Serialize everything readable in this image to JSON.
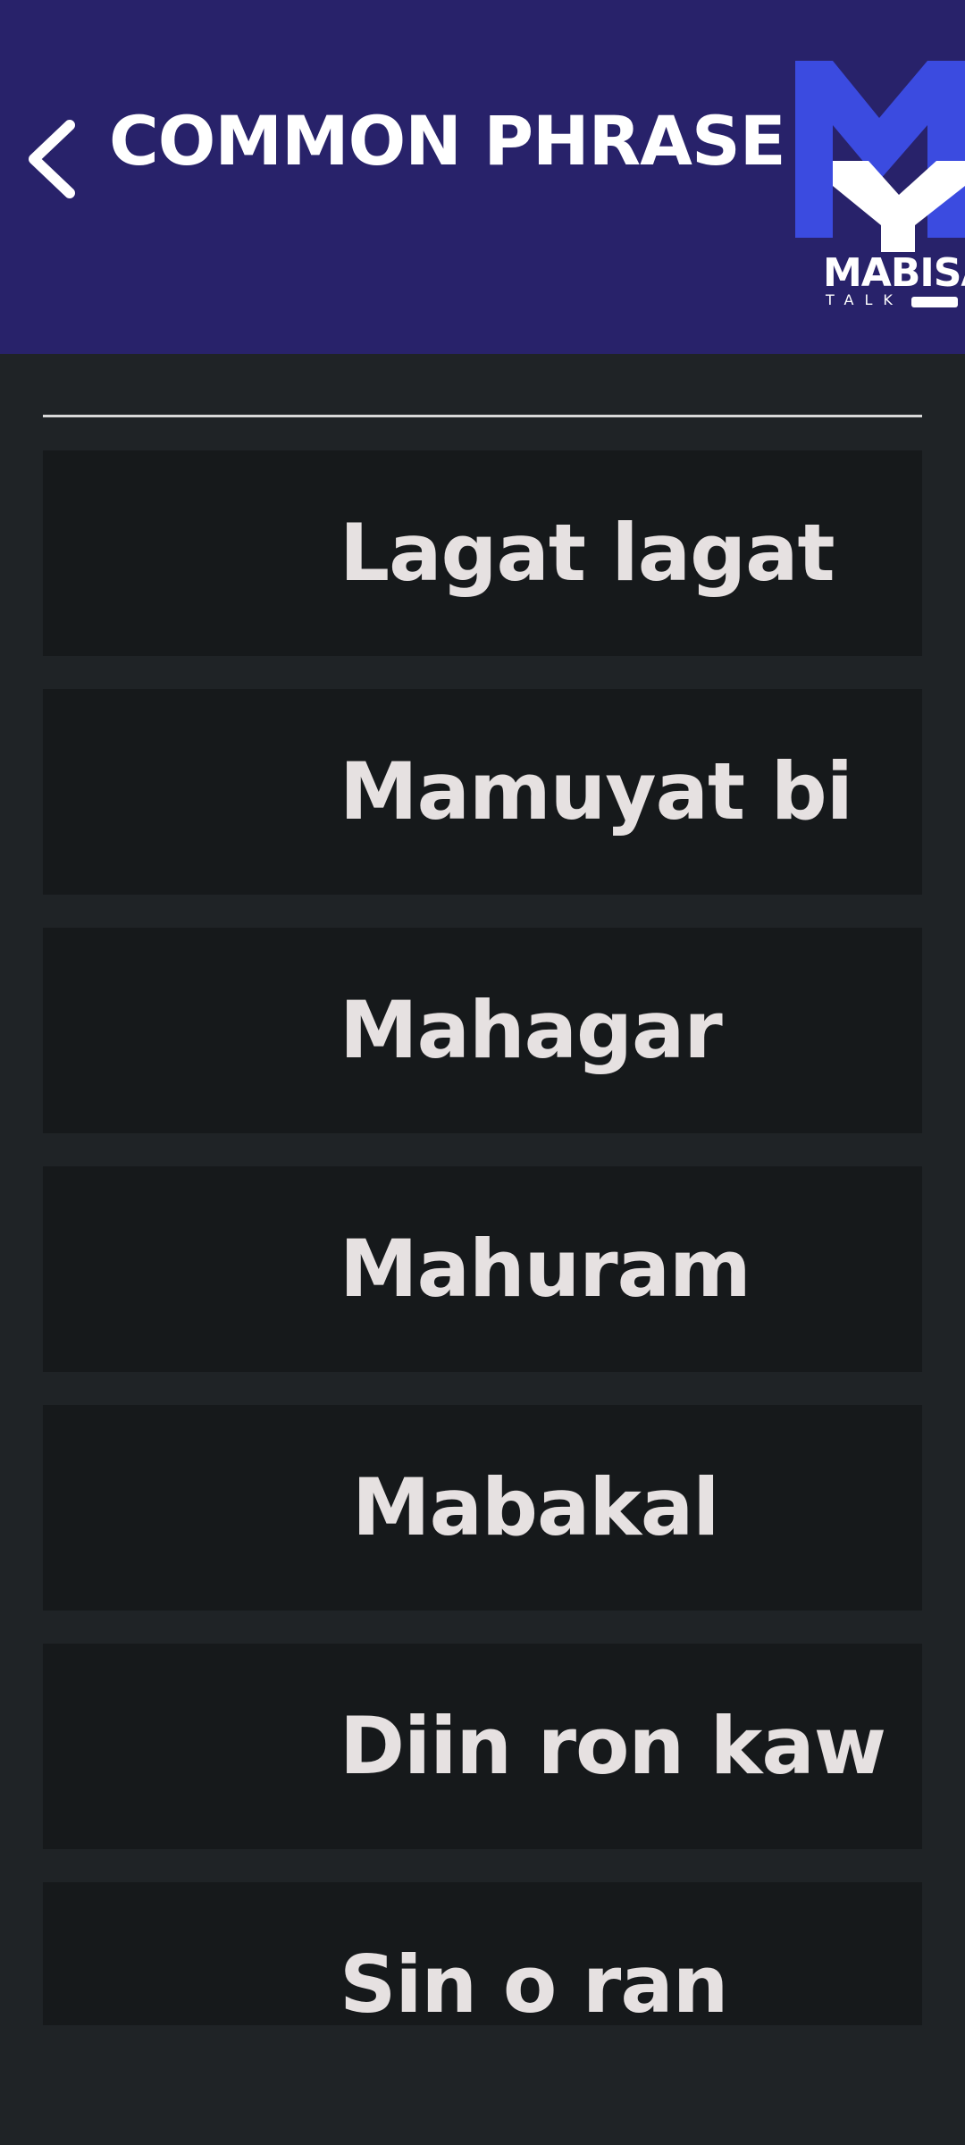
{
  "header": {
    "title": "COMMON PHRASE",
    "back_icon": "chevron-left-icon",
    "logo": {
      "wordmark": "MABISA",
      "subtitle": "TALK",
      "colors": {
        "blue": "#3b4be0",
        "white": "#ffffff"
      }
    }
  },
  "colors": {
    "header_bg": "#28226a",
    "page_bg": "#1f2326",
    "item_bg": "#16191b",
    "item_text": "#e6e1e1",
    "divider": "#d9d9d9"
  },
  "phrases": [
    {
      "label": "Lagat lagat"
    },
    {
      "label": "Mamuyat bi"
    },
    {
      "label": "Mahagar"
    },
    {
      "label": "Mahuram"
    },
    {
      "label": "Mabakal"
    },
    {
      "label": "Diin ron kaw"
    },
    {
      "label": "Sin o ran"
    }
  ]
}
